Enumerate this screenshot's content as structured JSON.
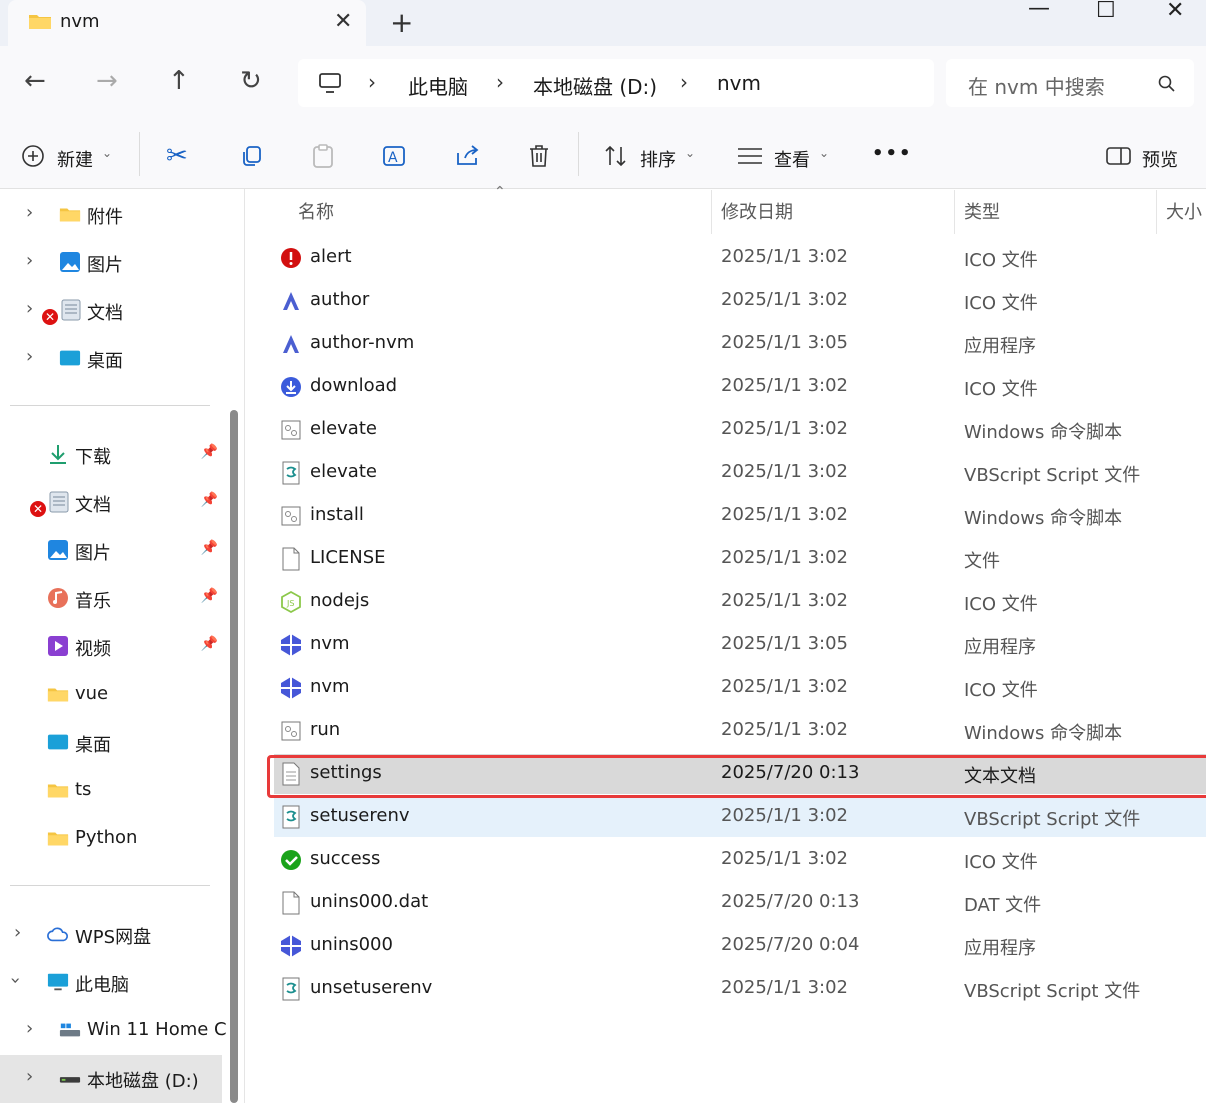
{
  "window": {
    "tab_title": "nvm",
    "tab_close": "✕",
    "new_tab": "+",
    "minimize": "—",
    "maximize": "☐",
    "close": "✕"
  },
  "breadcrumb": {
    "items": [
      "此电脑",
      "本地磁盘 (D:)",
      "nvm"
    ],
    "separator": "›"
  },
  "search": {
    "placeholder": "在 nvm 中搜索"
  },
  "toolbar": {
    "new_label": "新建",
    "sort_label": "排序",
    "view_label": "查看",
    "more_label": "•••",
    "preview_label": "预览"
  },
  "sidebar": {
    "top_items": [
      {
        "label": "附件",
        "icon": "folder-icon"
      },
      {
        "label": "图片",
        "icon": "pictures-icon"
      },
      {
        "label": "文档",
        "icon": "documents-icon"
      },
      {
        "label": "桌面",
        "icon": "desktop-icon"
      }
    ],
    "quick_items": [
      {
        "label": "下载",
        "icon": "download-icon"
      },
      {
        "label": "文档",
        "icon": "documents-icon"
      },
      {
        "label": "图片",
        "icon": "pictures-icon"
      },
      {
        "label": "音乐",
        "icon": "music-icon"
      },
      {
        "label": "视频",
        "icon": "video-icon"
      },
      {
        "label": "vue",
        "icon": "folder-icon"
      },
      {
        "label": "桌面",
        "icon": "desktop-icon"
      },
      {
        "label": "ts",
        "icon": "folder-icon"
      },
      {
        "label": "Python",
        "icon": "folder-icon"
      }
    ],
    "bottom_items": [
      {
        "label": "WPS网盘",
        "icon": "cloud-icon"
      },
      {
        "label": "此电脑",
        "icon": "computer-icon"
      },
      {
        "label": "Win 11 Home C",
        "icon": "drive-icon"
      },
      {
        "label": "本地磁盘 (D:)",
        "icon": "drive-icon"
      }
    ]
  },
  "columns": {
    "name": "名称",
    "date": "修改日期",
    "type": "类型",
    "size": "大小"
  },
  "files": [
    {
      "name": "alert",
      "date": "2025/1/1 3:02",
      "type": "ICO 文件",
      "icon": "alert-icon"
    },
    {
      "name": "author",
      "date": "2025/1/1 3:02",
      "type": "ICO 文件",
      "icon": "author-icon"
    },
    {
      "name": "author-nvm",
      "date": "2025/1/1 3:05",
      "type": "应用程序",
      "icon": "author-icon"
    },
    {
      "name": "download",
      "date": "2025/1/1 3:02",
      "type": "ICO 文件",
      "icon": "download-circle-icon"
    },
    {
      "name": "elevate",
      "date": "2025/1/1 3:02",
      "type": "Windows 命令脚本",
      "icon": "script-icon"
    },
    {
      "name": "elevate",
      "date": "2025/1/1 3:02",
      "type": "VBScript Script 文件",
      "icon": "vbscript-icon"
    },
    {
      "name": "install",
      "date": "2025/1/1 3:02",
      "type": "Windows 命令脚本",
      "icon": "script-icon"
    },
    {
      "name": "LICENSE",
      "date": "2025/1/1 3:02",
      "type": "文件",
      "icon": "file-icon"
    },
    {
      "name": "nodejs",
      "date": "2025/1/1 3:02",
      "type": "ICO 文件",
      "icon": "nodejs-icon"
    },
    {
      "name": "nvm",
      "date": "2025/1/1 3:05",
      "type": "应用程序",
      "icon": "nvm-icon"
    },
    {
      "name": "nvm",
      "date": "2025/1/1 3:02",
      "type": "ICO 文件",
      "icon": "nvm-icon"
    },
    {
      "name": "run",
      "date": "2025/1/1 3:02",
      "type": "Windows 命令脚本",
      "icon": "script-icon"
    },
    {
      "name": "settings",
      "date": "2025/7/20 0:13",
      "type": "文本文档",
      "icon": "text-file-icon"
    },
    {
      "name": "setuserenv",
      "date": "2025/1/1 3:02",
      "type": "VBScript Script 文件",
      "icon": "vbscript-icon"
    },
    {
      "name": "success",
      "date": "2025/1/1 3:02",
      "type": "ICO 文件",
      "icon": "success-icon"
    },
    {
      "name": "unins000.dat",
      "date": "2025/7/20 0:13",
      "type": "DAT 文件",
      "icon": "file-icon"
    },
    {
      "name": "unins000",
      "date": "2025/7/20 0:04",
      "type": "应用程序",
      "icon": "nvm-icon"
    },
    {
      "name": "unsetuserenv",
      "date": "2025/1/1 3:02",
      "type": "VBScript Script 文件",
      "icon": "vbscript-icon"
    }
  ],
  "colors": {
    "accent": "#1a63c5",
    "highlight_border": "#e83a3a",
    "folder": "#f5c542"
  }
}
